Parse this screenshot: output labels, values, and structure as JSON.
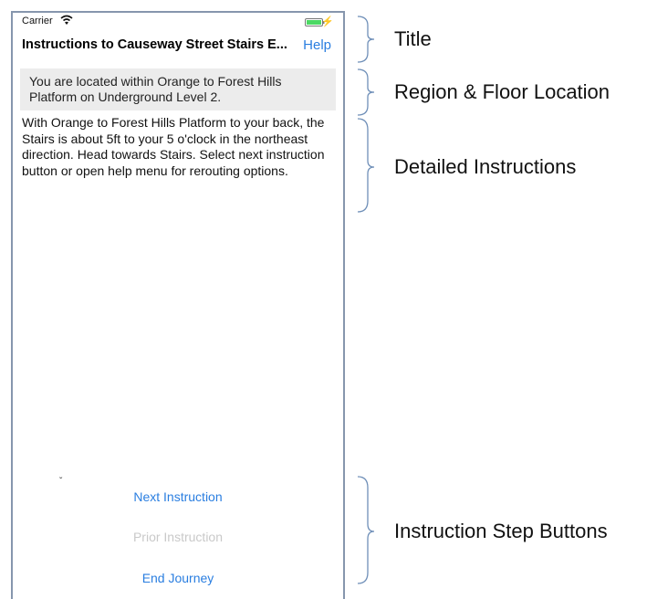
{
  "status_bar": {
    "carrier": "Carrier"
  },
  "nav": {
    "title": "Instructions to Causeway Street Stairs E...",
    "help_label": "Help"
  },
  "region": {
    "text": "You are located within Orange to Forest Hills Platform on Underground Level 2."
  },
  "instructions": {
    "text": "With Orange to Forest Hills Platform to your back, the Stairs is about 5ft to your 5 o'clock in the northeast direction.  Head towards Stairs.  Select next instruction button or open help menu for rerouting options."
  },
  "buttons": {
    "next": "Next Instruction",
    "prior": "Prior Instruction",
    "end": "End Journey"
  },
  "annotations": {
    "title": "Title",
    "region": "Region & Floor Location",
    "detailed": "Detailed Instructions",
    "steps": "Instruction Step Buttons"
  },
  "colors": {
    "accent": "#2a7ee0",
    "disabled": "#c9c9c9",
    "region_bg": "#ececec",
    "battery": "#4cd964"
  }
}
